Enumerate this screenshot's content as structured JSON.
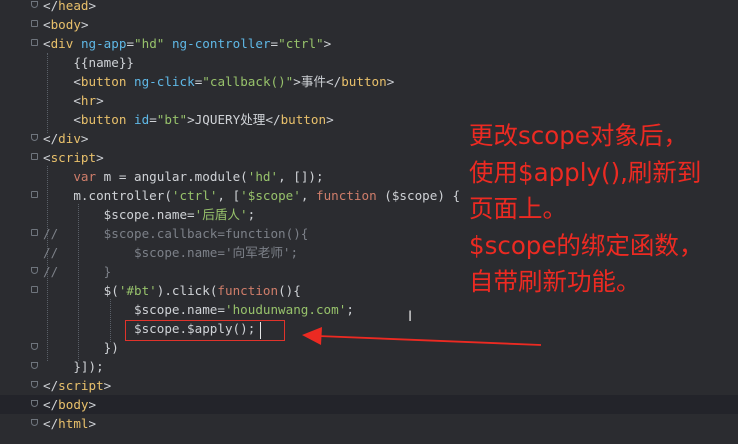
{
  "colors": {
    "background": "#2b2c30",
    "tag": "#e8c06b",
    "attribute": "#5fb8e6",
    "string": "#97c26b",
    "keyword": "#cf7d6a",
    "text": "#cfd2d6",
    "comment": "#7c8088",
    "annotation": "#ec2a22"
  },
  "editor": {
    "lines": [
      {
        "fold": "close",
        "tokens": [
          {
            "t": "</",
            "c": "p"
          },
          {
            "t": "head",
            "c": "tag"
          },
          {
            "t": ">",
            "c": "p"
          }
        ]
      },
      {
        "fold": "open",
        "tokens": [
          {
            "t": "<",
            "c": "p"
          },
          {
            "t": "body",
            "c": "tag"
          },
          {
            "t": ">",
            "c": "p"
          }
        ]
      },
      {
        "fold": "open",
        "tokens": [
          {
            "t": "<",
            "c": "p"
          },
          {
            "t": "div",
            "c": "tag"
          },
          {
            "t": " ",
            "c": "p"
          },
          {
            "t": "ng-app",
            "c": "attr"
          },
          {
            "t": "=",
            "c": "p"
          },
          {
            "t": "\"hd\"",
            "c": "str"
          },
          {
            "t": " ",
            "c": "p"
          },
          {
            "t": "ng-controller",
            "c": "attr"
          },
          {
            "t": "=",
            "c": "p"
          },
          {
            "t": "\"ctrl\"",
            "c": "str"
          },
          {
            "t": ">",
            "c": "p"
          }
        ]
      },
      {
        "tokens": [
          {
            "t": "    {{name}}",
            "c": "p"
          }
        ]
      },
      {
        "tokens": [
          {
            "t": "    <",
            "c": "p"
          },
          {
            "t": "button",
            "c": "tag"
          },
          {
            "t": " ",
            "c": "p"
          },
          {
            "t": "ng-click",
            "c": "attr"
          },
          {
            "t": "=",
            "c": "p"
          },
          {
            "t": "\"callback()\"",
            "c": "str"
          },
          {
            "t": ">事件</",
            "c": "p"
          },
          {
            "t": "button",
            "c": "tag"
          },
          {
            "t": ">",
            "c": "p"
          }
        ]
      },
      {
        "tokens": [
          {
            "t": "    <",
            "c": "p"
          },
          {
            "t": "hr",
            "c": "tag"
          },
          {
            "t": ">",
            "c": "p"
          }
        ]
      },
      {
        "tokens": [
          {
            "t": "    <",
            "c": "p"
          },
          {
            "t": "button",
            "c": "tag"
          },
          {
            "t": " ",
            "c": "p"
          },
          {
            "t": "id",
            "c": "attr"
          },
          {
            "t": "=",
            "c": "p"
          },
          {
            "t": "\"bt\"",
            "c": "str"
          },
          {
            "t": ">JQUERY处理</",
            "c": "p"
          },
          {
            "t": "button",
            "c": "tag"
          },
          {
            "t": ">",
            "c": "p"
          }
        ]
      },
      {
        "fold": "close",
        "tokens": [
          {
            "t": "</",
            "c": "p"
          },
          {
            "t": "div",
            "c": "tag"
          },
          {
            "t": ">",
            "c": "p"
          }
        ]
      },
      {
        "fold": "open",
        "tokens": [
          {
            "t": "<",
            "c": "p"
          },
          {
            "t": "script",
            "c": "tag"
          },
          {
            "t": ">",
            "c": "p"
          }
        ]
      },
      {
        "tokens": [
          {
            "t": "    ",
            "c": "p"
          },
          {
            "t": "var",
            "c": "kw"
          },
          {
            "t": " m = angular.module(",
            "c": "p"
          },
          {
            "t": "'hd'",
            "c": "str"
          },
          {
            "t": ", []);",
            "c": "p"
          }
        ]
      },
      {
        "fold": "open",
        "tokens": [
          {
            "t": "    m.controller(",
            "c": "p"
          },
          {
            "t": "'ctrl'",
            "c": "str"
          },
          {
            "t": ", [",
            "c": "p"
          },
          {
            "t": "'$scope'",
            "c": "str"
          },
          {
            "t": ", ",
            "c": "p"
          },
          {
            "t": "function",
            "c": "kw"
          },
          {
            "t": " ($scope) {",
            "c": "p"
          }
        ]
      },
      {
        "tokens": [
          {
            "t": "        $scope.name=",
            "c": "p"
          },
          {
            "t": "'后盾人'",
            "c": "str"
          },
          {
            "t": ";",
            "c": "p"
          }
        ]
      },
      {
        "fold": "open",
        "tokens": [
          {
            "t": "//      $scope.callback=function(){",
            "c": "cm"
          }
        ]
      },
      {
        "tokens": [
          {
            "t": "//          $scope.name='向军老师';",
            "c": "cm"
          }
        ]
      },
      {
        "fold": "close",
        "tokens": [
          {
            "t": "//      }",
            "c": "cm"
          }
        ]
      },
      {
        "fold": "open",
        "tokens": [
          {
            "t": "        $(",
            "c": "p"
          },
          {
            "t": "'#bt'",
            "c": "str"
          },
          {
            "t": ").click(",
            "c": "p"
          },
          {
            "t": "function",
            "c": "kw"
          },
          {
            "t": "(){",
            "c": "p"
          }
        ]
      },
      {
        "tokens": [
          {
            "t": "            $scope.name=",
            "c": "p"
          },
          {
            "t": "'houdunwang.com'",
            "c": "str"
          },
          {
            "t": ";",
            "c": "p"
          }
        ]
      },
      {
        "tokens": [
          {
            "t": "            $scope.$apply();",
            "c": "p"
          }
        ]
      },
      {
        "fold": "close",
        "tokens": [
          {
            "t": "        })",
            "c": "p"
          }
        ]
      },
      {
        "fold": "close",
        "tokens": [
          {
            "t": "    }]);",
            "c": "p"
          }
        ]
      },
      {
        "fold": "close",
        "tokens": [
          {
            "t": "</",
            "c": "p"
          },
          {
            "t": "script",
            "c": "tag"
          },
          {
            "t": ">",
            "c": "p"
          }
        ]
      },
      {
        "fold": "close",
        "highlight": true,
        "tokens": [
          {
            "t": "</",
            "c": "p"
          },
          {
            "t": "body",
            "c": "tag"
          },
          {
            "t": ">",
            "c": "p"
          }
        ]
      },
      {
        "fold": "close",
        "tokens": [
          {
            "t": "</",
            "c": "p"
          },
          {
            "t": "html",
            "c": "tag"
          },
          {
            "t": ">",
            "c": "p"
          }
        ]
      }
    ]
  },
  "annotation": {
    "lines": [
      "更改scope对象后，",
      "使用$apply(),刷新到",
      "页面上。",
      "$scope的绑定函数，",
      "自带刷新功能。"
    ]
  }
}
